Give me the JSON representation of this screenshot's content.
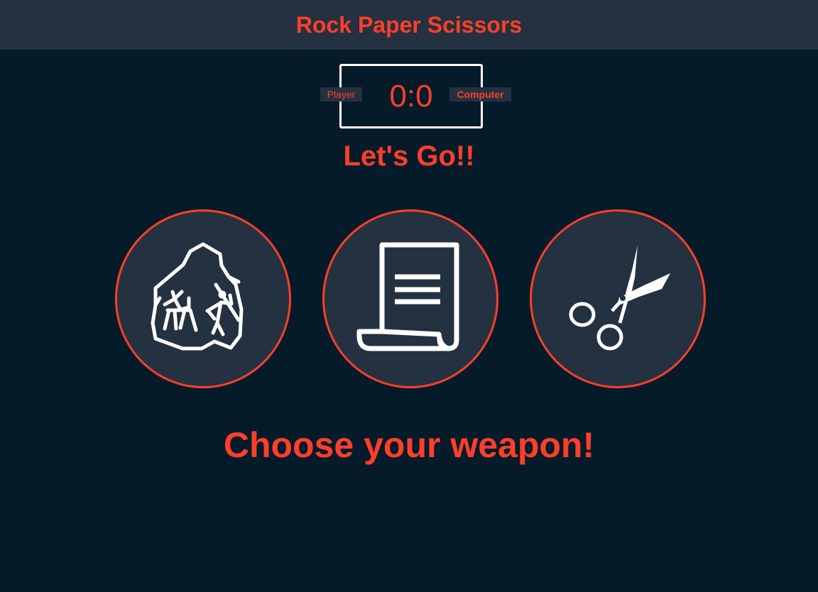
{
  "header": {
    "title": "Rock Paper Scissors"
  },
  "scoreboard": {
    "player_label": "Player",
    "computer_label": "Computer",
    "player_score": 0,
    "computer_score": 0,
    "score_text": "0:0"
  },
  "result": {
    "text": "Let's Go!!"
  },
  "choices": [
    {
      "id": "rock",
      "icon": "rock-icon"
    },
    {
      "id": "paper",
      "icon": "paper-icon"
    },
    {
      "id": "scissors",
      "icon": "scissors-icon"
    }
  ],
  "message": {
    "text": "Choose your weapon!"
  },
  "colors": {
    "accent": "#ff3e2a",
    "background": "#061b29",
    "panel": "#243140",
    "icon": "#ffffff"
  }
}
